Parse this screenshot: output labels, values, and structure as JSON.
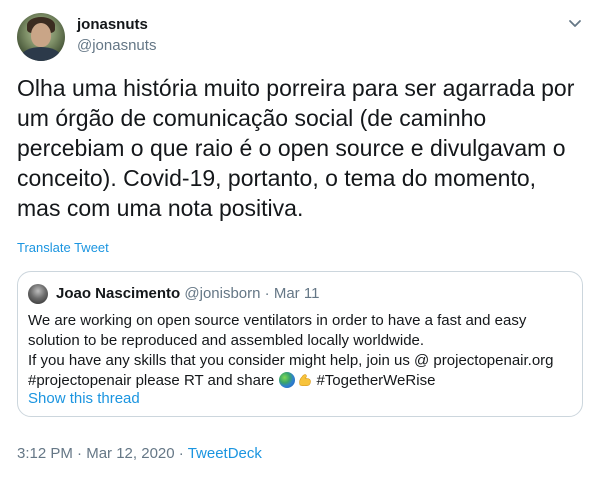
{
  "tweet": {
    "author_name": "jonasnuts",
    "author_handle": "@jonasnuts",
    "text_lines": [
      "Olha uma história muito porreira para ser agarrada por",
      "um órgão de comunicação social (de caminho",
      "percebiam o que raio é o open source e divulgavam o",
      "conceito). Covid-19, portanto, o tema do momento,",
      "mas com uma nota positiva."
    ],
    "translate_label": "Translate Tweet",
    "time": "3:12 PM",
    "separator": "·",
    "date": "Mar 12, 2020",
    "source": "TweetDeck"
  },
  "quoted": {
    "author_name": "Joao Nascimento",
    "author_handle": "@jonisborn",
    "separator": "·",
    "date": "Mar 11",
    "line1": "We are working on open source ventilators in order to have a fast and easy",
    "line2": "solution to be reproduced and assembled locally worldwide.",
    "line3": "If you have any skills that you consider might help, join us @ projectopenair.org",
    "line4_before": "#projectopenair please RT and share",
    "line4_after": "#TogetherWeRise",
    "show_thread_label": "Show this thread"
  },
  "colors": {
    "link": "#1b95e0",
    "secondary_text": "#657786",
    "primary_text": "#14171a",
    "border": "#ccd6dd"
  },
  "icons": {
    "menu": "chevron-down-icon",
    "emoji_1": "globe-emoji",
    "emoji_2": "flexed-biceps-emoji"
  }
}
